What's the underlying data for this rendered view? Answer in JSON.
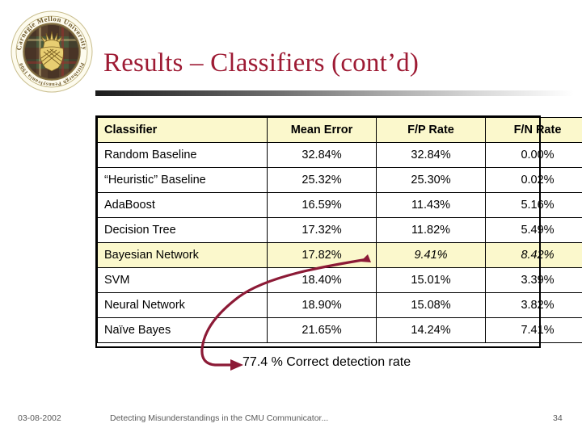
{
  "slide": {
    "title": "Results – Classifiers (cont’d)",
    "title_color": "#9E1B34",
    "background_color": "#ffffff"
  },
  "logo": {
    "name": "carnegie-mellon-university-seal",
    "top_text": "Carnegie Mellon University",
    "bottom_text": "Pittsburgh Pennsylvania 1900"
  },
  "table": {
    "header_background": "#FBF8CC",
    "highlight_background": "#FBF8CC",
    "columns": [
      "Classifier",
      "Mean Error",
      "F/P Rate",
      "F/N Rate"
    ],
    "rows": [
      {
        "classifier": "Random Baseline",
        "mean_error": "32.84%",
        "fp_rate": "32.84%",
        "fn_rate": "0.00%",
        "highlighted": false
      },
      {
        "classifier": "“Heuristic” Baseline",
        "mean_error": "25.32%",
        "fp_rate": "25.30%",
        "fn_rate": "0.02%",
        "highlighted": false
      },
      {
        "classifier": "AdaBoost",
        "mean_error": "16.59%",
        "fp_rate": "11.43%",
        "fn_rate": "5.16%",
        "highlighted": false
      },
      {
        "classifier": "Decision Tree",
        "mean_error": "17.32%",
        "fp_rate": "11.82%",
        "fn_rate": "5.49%",
        "highlighted": false
      },
      {
        "classifier": "Bayesian Network",
        "mean_error": "17.82%",
        "fp_rate": "9.41%",
        "fn_rate": "8.42%",
        "highlighted": true
      },
      {
        "classifier": "SVM",
        "mean_error": "18.40%",
        "fp_rate": "15.01%",
        "fn_rate": "3.39%",
        "highlighted": false
      },
      {
        "classifier": "Neural Network",
        "mean_error": "18.90%",
        "fp_rate": "15.08%",
        "fn_rate": "3.82%",
        "highlighted": false
      },
      {
        "classifier": "Naïve Bayes",
        "mean_error": "21.65%",
        "fp_rate": "14.24%",
        "fn_rate": "7.41%",
        "highlighted": false
      }
    ]
  },
  "annotation": {
    "caption": "77.4 % Correct detection rate",
    "arrow_color": "#8C1A36",
    "arrow_source_cell": "9.41%"
  },
  "footer": {
    "date": "03-08-2002",
    "text": "Detecting Misunderstandings in the CMU Communicator...",
    "page_number": "34"
  }
}
